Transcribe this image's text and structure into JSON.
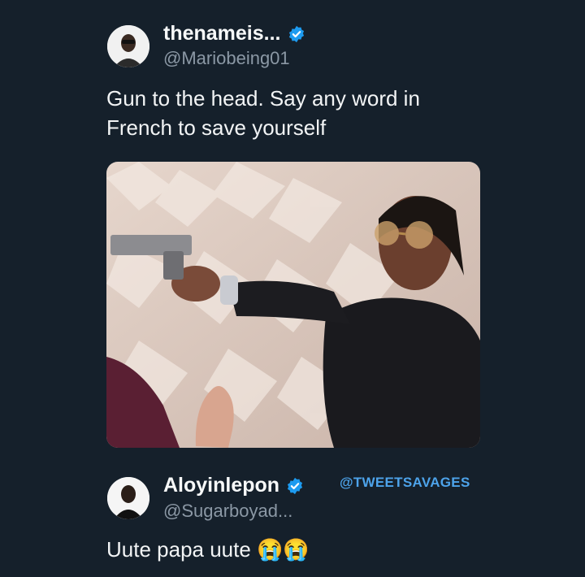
{
  "tweet": {
    "display_name": "thenameis...",
    "handle": "@Mariobeing01",
    "text": "Gun to the head. Say any word in\nFrench to save yourself",
    "avatar_icon": "user-avatar-icon",
    "verified_icon": "verified-badge-icon"
  },
  "reply": {
    "display_name": "Aloyinlepon",
    "handle": "@Sugarboyad...",
    "text": "Uute papa uute 😭😭",
    "avatar_icon": "user-avatar-icon",
    "verified_icon": "verified-badge-icon"
  },
  "watermark": "@TWEETSAVAGES",
  "colors": {
    "background": "#15202b",
    "verified": "#1d9bf0",
    "handle": "#8b98a5",
    "watermark": "#4da3ea"
  }
}
